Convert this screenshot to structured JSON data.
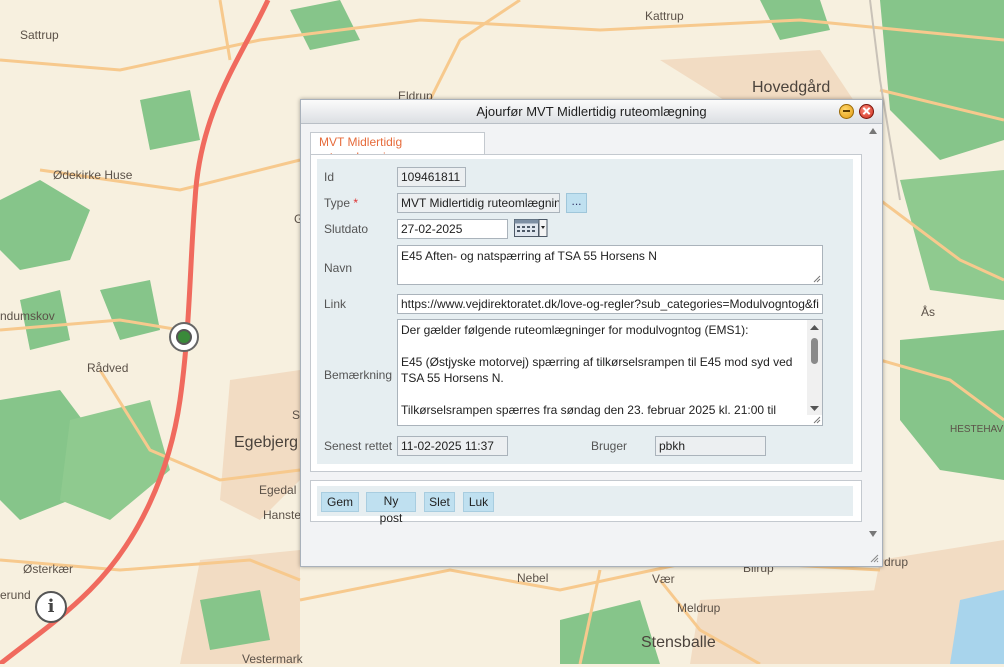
{
  "map": {
    "places": [
      {
        "id": "sattrup",
        "label": "Sattrup"
      },
      {
        "id": "kattrup",
        "label": "Kattrup"
      },
      {
        "id": "hovedgaard",
        "label": "Hovedgård"
      },
      {
        "id": "eldrup",
        "label": "Eldrup"
      },
      {
        "id": "oedekirke",
        "label": "Ødekirke Huse"
      },
      {
        "id": "ndumskov",
        "label": "ndumskov"
      },
      {
        "id": "raadved",
        "label": "Rådved"
      },
      {
        "id": "egebjerg",
        "label": "Egebjerg"
      },
      {
        "id": "egedal",
        "label": "Egedal"
      },
      {
        "id": "hanste",
        "label": "Hanste"
      },
      {
        "id": "osterkaer",
        "label": "Østerkær"
      },
      {
        "id": "erund",
        "label": "erund"
      },
      {
        "id": "vestermark",
        "label": "Vestermark"
      },
      {
        "id": "nebel",
        "label": "Nebel"
      },
      {
        "id": "vaer",
        "label": "Vær"
      },
      {
        "id": "meldrup",
        "label": "Meldrup"
      },
      {
        "id": "stensballe",
        "label": "Stensballe"
      },
      {
        "id": "bilrup",
        "label": "Bilrup"
      },
      {
        "id": "drup",
        "label": "drup"
      },
      {
        "id": "aas",
        "label": "Ås"
      },
      {
        "id": "hestehave",
        "label": "HESTEHAVE"
      },
      {
        "id": "g",
        "label": "G"
      },
      {
        "id": "s",
        "label": "S"
      }
    ]
  },
  "dialog": {
    "title": "Ajourfør MVT Midlertidig ruteomlægning",
    "tab_label": "MVT Midlertidig ruteomlægning",
    "fields": {
      "id_label": "Id",
      "id_value": "109461811",
      "type_label": "Type",
      "type_required": "*",
      "type_value": "MVT Midlertidig ruteomlægning",
      "type_lookup_label": "...",
      "slutdato_label": "Slutdato",
      "slutdato_value": "27-02-2025",
      "navn_label": "Navn",
      "navn_value": "E45 Aften- og natspærring af TSA 55 Horsens N",
      "link_label": "Link",
      "link_value": "https://www.vejdirektoratet.dk/love-og-regler?sub_categories=Modulvogntog&filters",
      "bemaerkning_label": "Bemærkning",
      "bemaerkning_value": "Der gælder følgende ruteomlægninger for modulvogntog (EMS1):\n\nE45 (Østjyske motorvej) spærring af tilkørselsrampen til E45 mod syd ved TSA 55 Horsens N.\n\nTilkørselsrampen spærres fra søndag den 23. februar 2025 kl. 21:00 til",
      "senest_label": "Senest rettet",
      "senest_value": "11-02-2025 11:37",
      "bruger_label": "Bruger",
      "bruger_value": "pbkh"
    },
    "buttons": {
      "gem": "Gem",
      "ny_post": "Ny post",
      "slet": "Slet",
      "luk": "Luk"
    }
  },
  "colors": {
    "map_bg": "#f7f0df",
    "forest": "#86c58a",
    "road_main": "#f06a5e",
    "road_secondary": "#f7c98d",
    "urban": "#f3ddc4",
    "tab_text": "#e66b3b",
    "panel_bg": "#e6eef1",
    "button_bg": "#bfe0f0"
  }
}
